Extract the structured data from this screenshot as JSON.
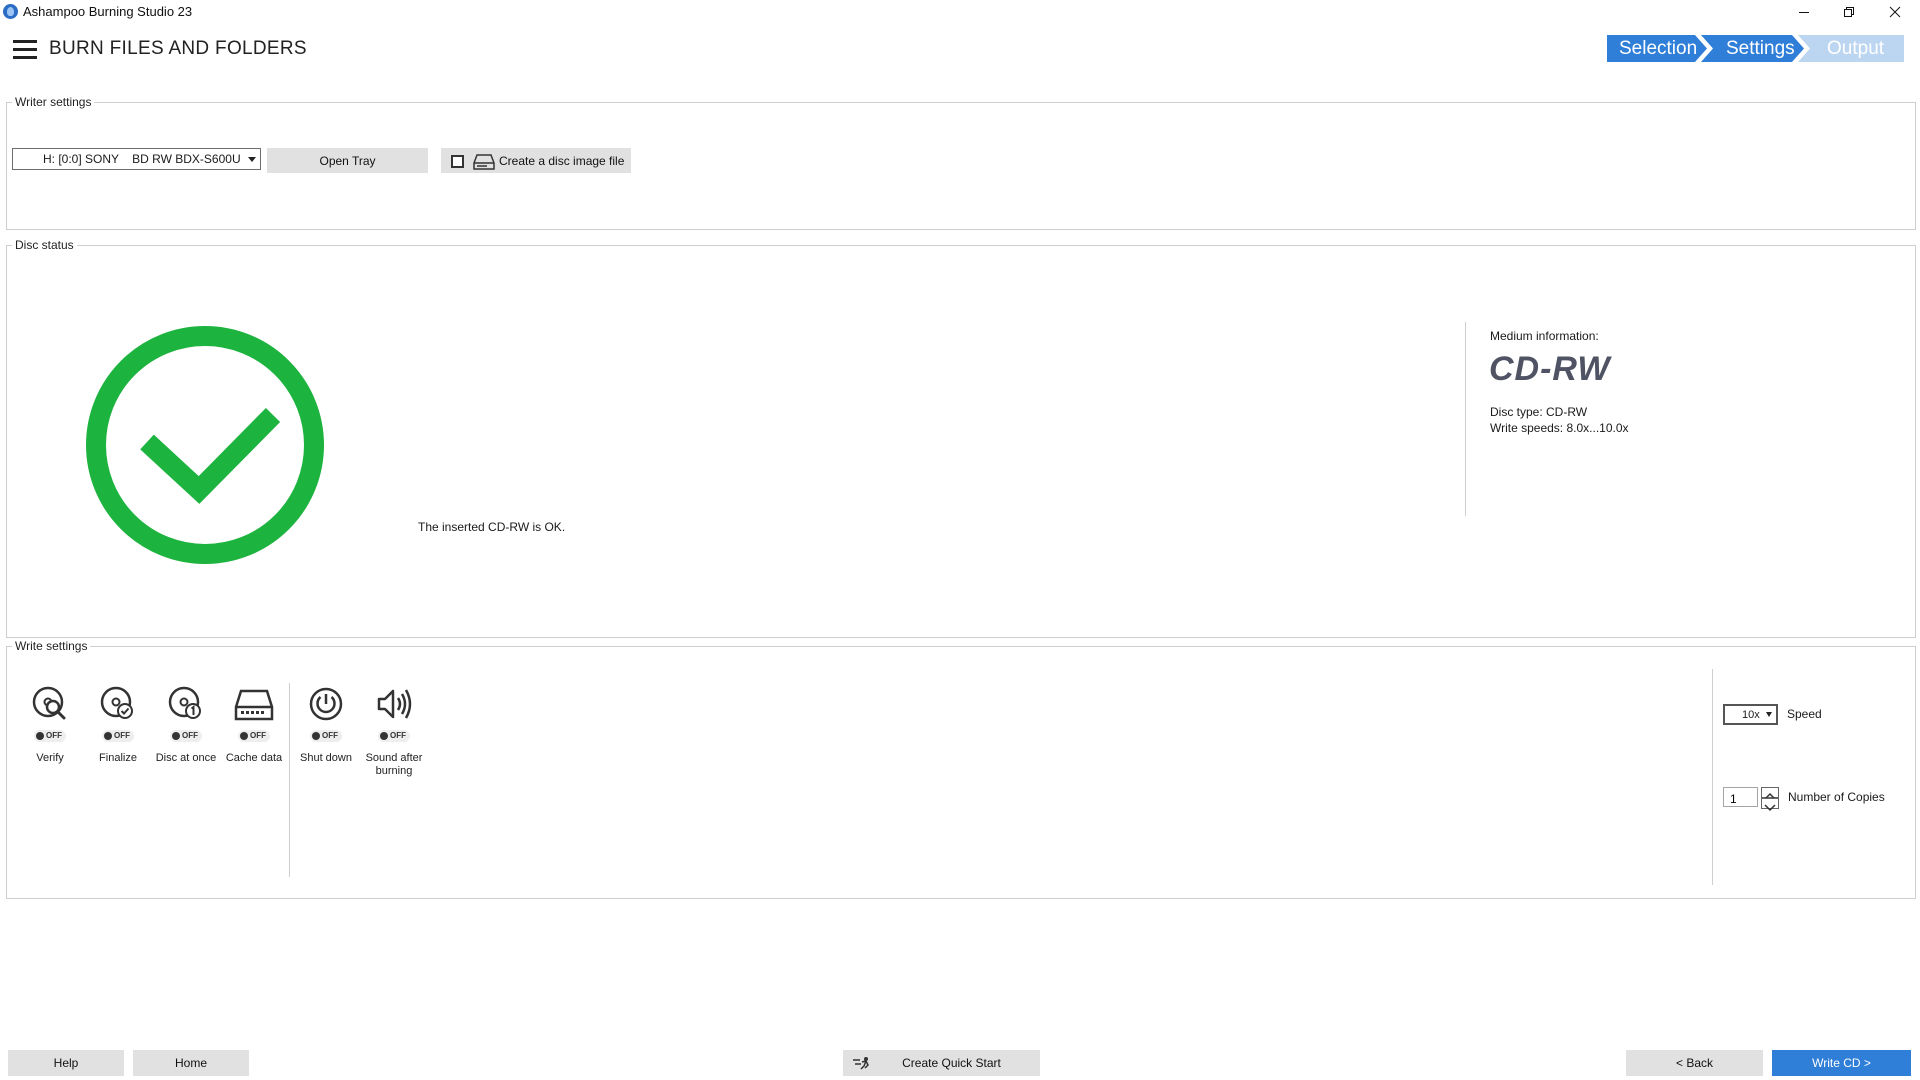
{
  "window": {
    "title": "Ashampoo Burning Studio 23",
    "app_icon": "ashampoo-flame-icon"
  },
  "header": {
    "title": "BURN FILES AND FOLDERS",
    "menu_icon": "hamburger-icon",
    "steps": [
      {
        "label": "Selection",
        "state": "done"
      },
      {
        "label": "Settings",
        "state": "active"
      },
      {
        "label": "Output",
        "state": "inactive"
      }
    ]
  },
  "writer_settings": {
    "legend": "Writer settings",
    "drive": "H: [0:0] SONY    BD RW BDX-S600U",
    "open_tray": "Open Tray",
    "disc_image_label": "Create a disc image file",
    "disc_image_checked": false
  },
  "disc_status": {
    "legend": "Disc status",
    "message": "The inserted CD-RW is OK.",
    "status_icon": "check-circle-icon",
    "status_color": "#1db33f",
    "medium_label": "Medium information:",
    "medium_type": "CD-RW",
    "disc_type": "Disc type: CD-RW",
    "write_speeds": "Write speeds: 8.0x...10.0x"
  },
  "write_settings": {
    "legend": "Write settings",
    "options": [
      {
        "label": "Verify",
        "icon": "verify-disc-icon",
        "state": "OFF"
      },
      {
        "label": "Finalize",
        "icon": "finalize-disc-icon",
        "state": "OFF"
      },
      {
        "label": "Disc at once",
        "icon": "disc-at-once-icon",
        "state": "OFF"
      },
      {
        "label": "Cache data",
        "icon": "cache-drive-icon",
        "state": "OFF"
      },
      {
        "label": "Shut down",
        "icon": "power-icon",
        "state": "OFF"
      },
      {
        "label": "Sound after burning",
        "icon": "speaker-icon",
        "state": "OFF"
      }
    ],
    "speed_value": "10x",
    "speed_label": "Speed",
    "copies_value": "1",
    "copies_label": "Number of Copies"
  },
  "footer": {
    "help": "Help",
    "home": "Home",
    "quick_start": "Create Quick Start",
    "back": "< Back",
    "write": "Write CD >"
  },
  "colors": {
    "accent": "#2f7ed8",
    "step_inactive": "#bcd6f2",
    "success": "#1db33f",
    "medium_text": "#4f5363"
  }
}
